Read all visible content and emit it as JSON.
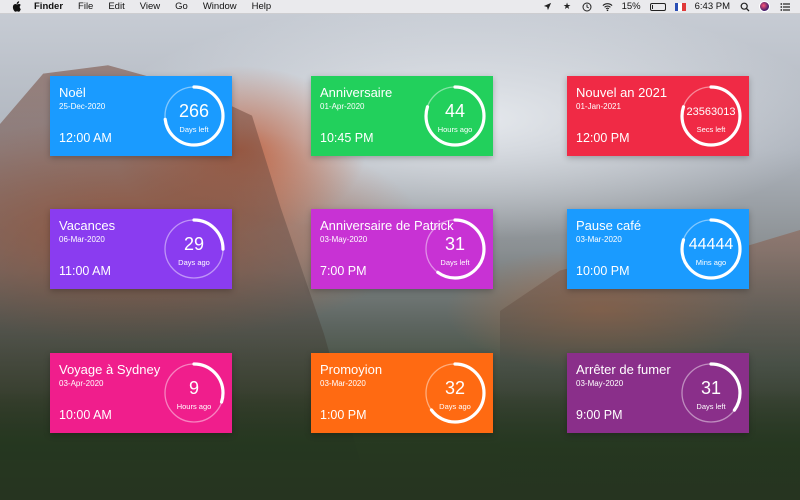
{
  "menubar": {
    "items": [
      "Finder",
      "File",
      "Edit",
      "View",
      "Go",
      "Window",
      "Help"
    ],
    "battery_percent": "15%",
    "battery_level": 0.15,
    "clock": "6:43 PM",
    "status_icons": [
      "location-arrow-icon",
      "star-icon",
      "time-machine-icon",
      "wifi-icon",
      "battery-icon",
      "flag-fr-icon",
      "search-icon",
      "avatar-icon",
      "list-icon"
    ]
  },
  "cards": [
    {
      "title": "Noël",
      "date": "25-Dec-2020",
      "time": "12:00 AM",
      "value": "266",
      "unit": "Days left",
      "color": "#1a9bff",
      "progress": 0.73
    },
    {
      "title": "Anniversaire",
      "date": "01-Apr-2020",
      "time": "10:45 PM",
      "value": "44",
      "unit": "Hours ago",
      "color": "#22d05c",
      "progress": 0.8
    },
    {
      "title": "Nouvel an 2021",
      "date": "01-Jan-2021",
      "time": "12:00 PM",
      "value": "23563013",
      "unit": "Secs left",
      "color": "#f02a45",
      "progress": 0.8
    },
    {
      "title": "Vacances",
      "date": "06-Mar-2020",
      "time": "11:00 AM",
      "value": "29",
      "unit": "Days ago",
      "color": "#8a3cf0",
      "progress": 0.25
    },
    {
      "title": "Anniversaire de Patrick",
      "date": "03-May-2020",
      "time": "7:00 PM",
      "value": "31",
      "unit": "Days left",
      "color": "#c832d4",
      "progress": 0.6
    },
    {
      "title": "Pause café",
      "date": "03-Mar-2020",
      "time": "10:00 PM",
      "value": "44444",
      "unit": "Mins ago",
      "color": "#1a9bff",
      "progress": 0.8
    },
    {
      "title": "Voyage à Sydney",
      "date": "03-Apr-2020",
      "time": "10:00 AM",
      "value": "9",
      "unit": "Hours ago",
      "color": "#f01e8c",
      "progress": 0.3
    },
    {
      "title": "Promoyion",
      "date": "03-Mar-2020",
      "time": "1:00 PM",
      "value": "32",
      "unit": "Days ago",
      "color": "#ff6a12",
      "progress": 0.65
    },
    {
      "title": "Arrêter de fumer",
      "date": "03-May-2020",
      "time": "9:00 PM",
      "value": "31",
      "unit": "Days left",
      "color": "#8a2f8a",
      "progress": 0.35
    }
  ]
}
